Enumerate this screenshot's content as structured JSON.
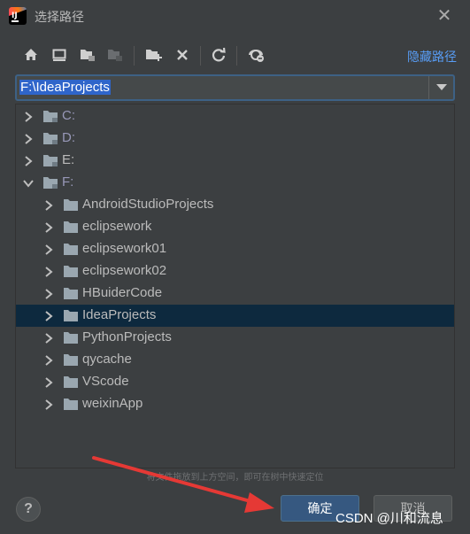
{
  "window": {
    "title": "选择路径",
    "app_icon": "intellij-idea-icon"
  },
  "toolbar": {
    "buttons": [
      "home-icon",
      "desktop-icon",
      "project-folder-icon",
      "module-folder-icon",
      "new-folder-icon",
      "delete-icon",
      "refresh-icon",
      "show-hidden-icon"
    ],
    "hide_path_label": "隐藏路径"
  },
  "path": {
    "value": "F:\\IdeaProjects"
  },
  "tree": {
    "drives": [
      {
        "label": "C:",
        "expanded": false
      },
      {
        "label": "D:",
        "expanded": false
      },
      {
        "label": "E:",
        "expanded": false
      },
      {
        "label": "F:",
        "expanded": true
      }
    ],
    "children": [
      "AndroidStudioProjects",
      "eclipsework",
      "eclipsework01",
      "eclipsework02",
      "HBuiderCode",
      "IdeaProjects",
      "PythonProjects",
      "qycache",
      "VScode",
      "weixinApp"
    ],
    "selected": "IdeaProjects"
  },
  "hint": "将文件拖放到上方空间，即可在树中快速定位",
  "footer": {
    "help_label": "?",
    "ok_label": "确定",
    "cancel_label": "取消"
  },
  "watermark": "CSDN @川和流息",
  "colors": {
    "background": "#3c3f41",
    "accent": "#589df6",
    "selection": "#0d293e",
    "ok_button": "#365880",
    "annotation_arrow": "#e53935"
  }
}
